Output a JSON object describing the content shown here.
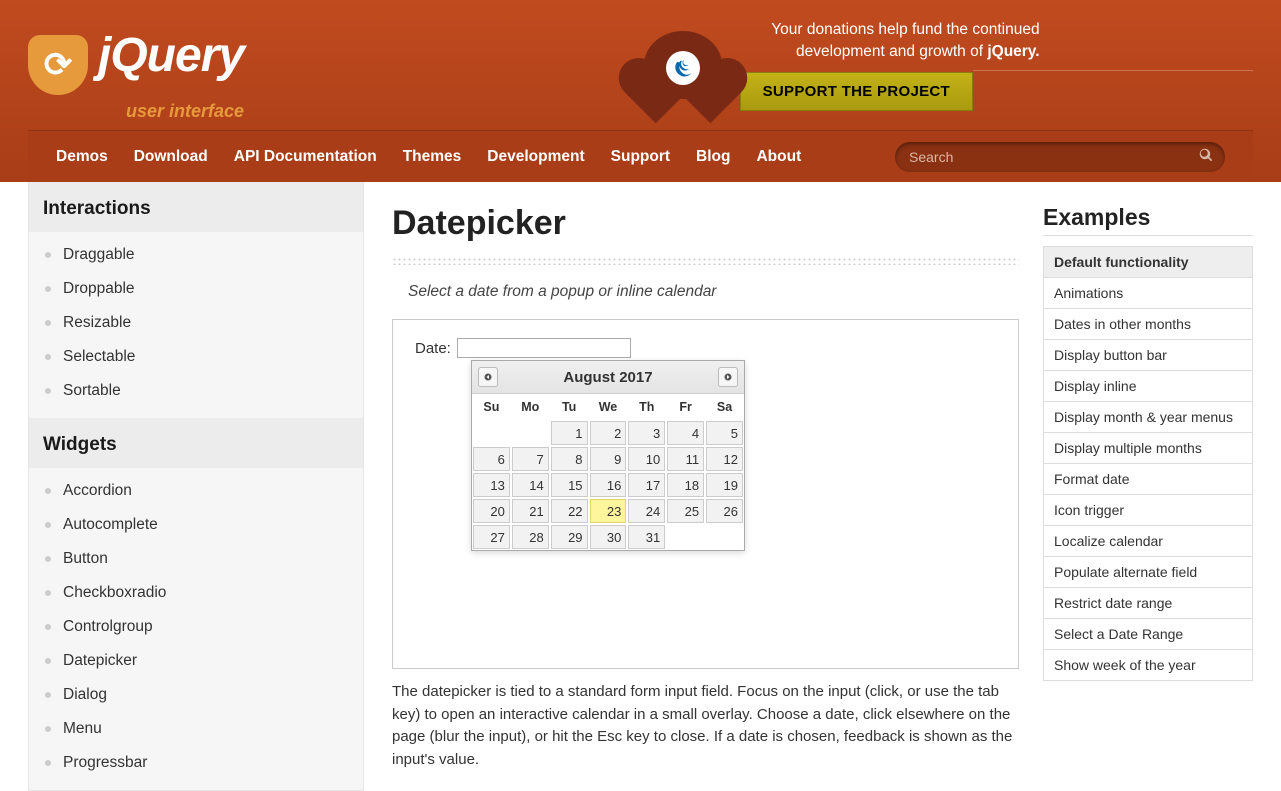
{
  "header": {
    "logo_main": "jQuery",
    "logo_sub": "user interface",
    "donation_text_1": "Your donations help fund the continued development and growth of ",
    "donation_text_bold": "jQuery.",
    "support_button": "SUPPORT THE PROJECT"
  },
  "nav": {
    "items": [
      "Demos",
      "Download",
      "API Documentation",
      "Themes",
      "Development",
      "Support",
      "Blog",
      "About"
    ],
    "search_placeholder": "Search"
  },
  "sidebar": {
    "groups": [
      {
        "title": "Interactions",
        "items": [
          "Draggable",
          "Droppable",
          "Resizable",
          "Selectable",
          "Sortable"
        ]
      },
      {
        "title": "Widgets",
        "items": [
          "Accordion",
          "Autocomplete",
          "Button",
          "Checkboxradio",
          "Controlgroup",
          "Datepicker",
          "Dialog",
          "Menu",
          "Progressbar"
        ]
      }
    ]
  },
  "content": {
    "page_title": "Datepicker",
    "subtitle": "Select a date from a popup or inline calendar",
    "date_label": "Date:",
    "body": "The datepicker is tied to a standard form input field. Focus on the input (click, or use the tab key) to open an interactive calendar in a small overlay. Choose a date, click elsewhere on the page (blur the input), or hit the Esc key to close. If a date is chosen, feedback is shown as the input's value."
  },
  "datepicker": {
    "title": "August 2017",
    "weekdays": [
      "Su",
      "Mo",
      "Tu",
      "We",
      "Th",
      "Fr",
      "Sa"
    ],
    "leading_blanks": 2,
    "days_in_month": 31,
    "today": 23
  },
  "examples": {
    "title": "Examples",
    "items": [
      {
        "label": "Default functionality",
        "active": true
      },
      {
        "label": "Animations"
      },
      {
        "label": "Dates in other months"
      },
      {
        "label": "Display button bar"
      },
      {
        "label": "Display inline"
      },
      {
        "label": "Display month & year menus"
      },
      {
        "label": "Display multiple months"
      },
      {
        "label": "Format date"
      },
      {
        "label": "Icon trigger"
      },
      {
        "label": "Localize calendar"
      },
      {
        "label": "Populate alternate field"
      },
      {
        "label": "Restrict date range"
      },
      {
        "label": "Select a Date Range"
      },
      {
        "label": "Show week of the year"
      }
    ]
  }
}
